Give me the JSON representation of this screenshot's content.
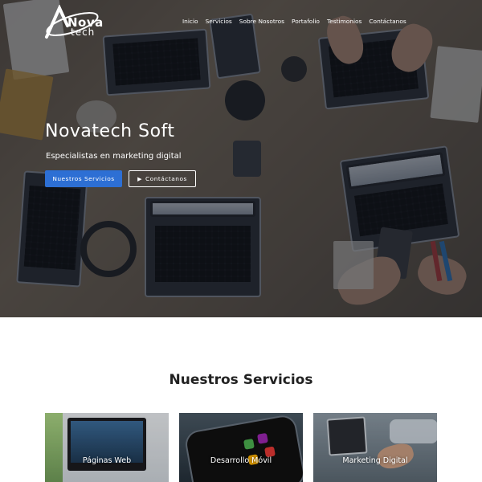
{
  "header": {
    "logo_word_1": "Nova",
    "logo_word_2": "tech"
  },
  "nav": {
    "items": [
      "Inicio",
      "Servicios",
      "Sobre Nosotros",
      "Portafolio",
      "Testimonios",
      "Contáctanos"
    ]
  },
  "hero": {
    "title": "Novatech Soft",
    "subtitle": "Especialistas en marketing digital",
    "primary_button": "Nuestros Servicios",
    "secondary_button": "Contáctanos",
    "secondary_button_icon": "play-icon"
  },
  "services": {
    "title": "Nuestros Servicios",
    "cards": [
      {
        "label": "Páginas Web"
      },
      {
        "label": "Desarrollo Móvil"
      },
      {
        "label": "Marketing Digital"
      }
    ]
  },
  "colors": {
    "primary": "#2d6fd4",
    "hero_overlay": "#141820",
    "text_dark": "#222222",
    "white": "#ffffff"
  }
}
